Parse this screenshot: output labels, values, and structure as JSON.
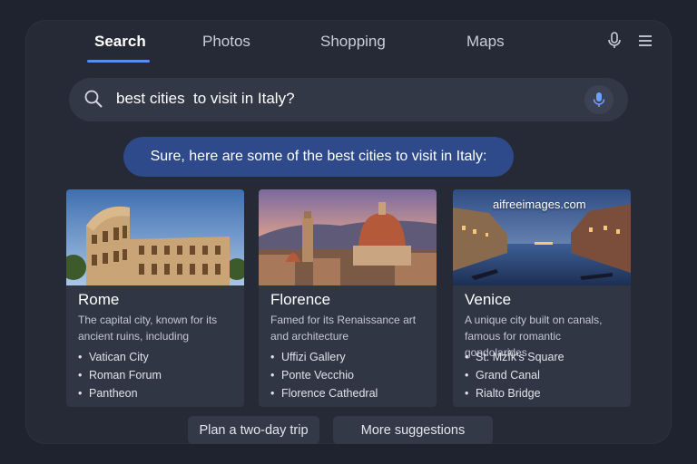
{
  "tabs": [
    {
      "label": "Search",
      "active": true
    },
    {
      "label": "Photos",
      "active": false
    },
    {
      "label": "Shopping",
      "active": false
    },
    {
      "label": "Maps",
      "active": false
    }
  ],
  "header_icons": [
    "microphone-icon",
    "menu-icon"
  ],
  "search": {
    "query": "best cities  to visit in Italy?",
    "icon": "search-icon",
    "voice_icon": "microphone-icon"
  },
  "answer": {
    "text": "Sure, here are some of the best cities to visit in Italy:"
  },
  "cards": [
    {
      "title": "Rome",
      "description": "The capital city, known for its ancient ruins, including",
      "items": [
        "Vatican City",
        "Roman Forum",
        "Pantheon"
      ],
      "image": "colosseum-photo"
    },
    {
      "title": "Florence",
      "description": "Famed for its Renaissance art and architecture",
      "items": [
        "Uffizi Gallery",
        "Ponte Vecchio",
        "Florence Cathedral"
      ],
      "image": "florence-duomo-photo"
    },
    {
      "title": "Venice",
      "description": "A unique city built on canals, famous for romantic gondolarides",
      "items": [
        "St. Mźİ́k's Square",
        "Grand Canal",
        "Rialto Bridge"
      ],
      "image": "venice-canal-photo",
      "watermark": "aifreeimages.com"
    }
  ],
  "suggestions": [
    "Plan a two-day trip",
    "More suggestions"
  ],
  "colors": {
    "accent": "#5b8def",
    "bubble": "#2f4a8a",
    "panel": "#252a36",
    "background": "#1f2330"
  }
}
